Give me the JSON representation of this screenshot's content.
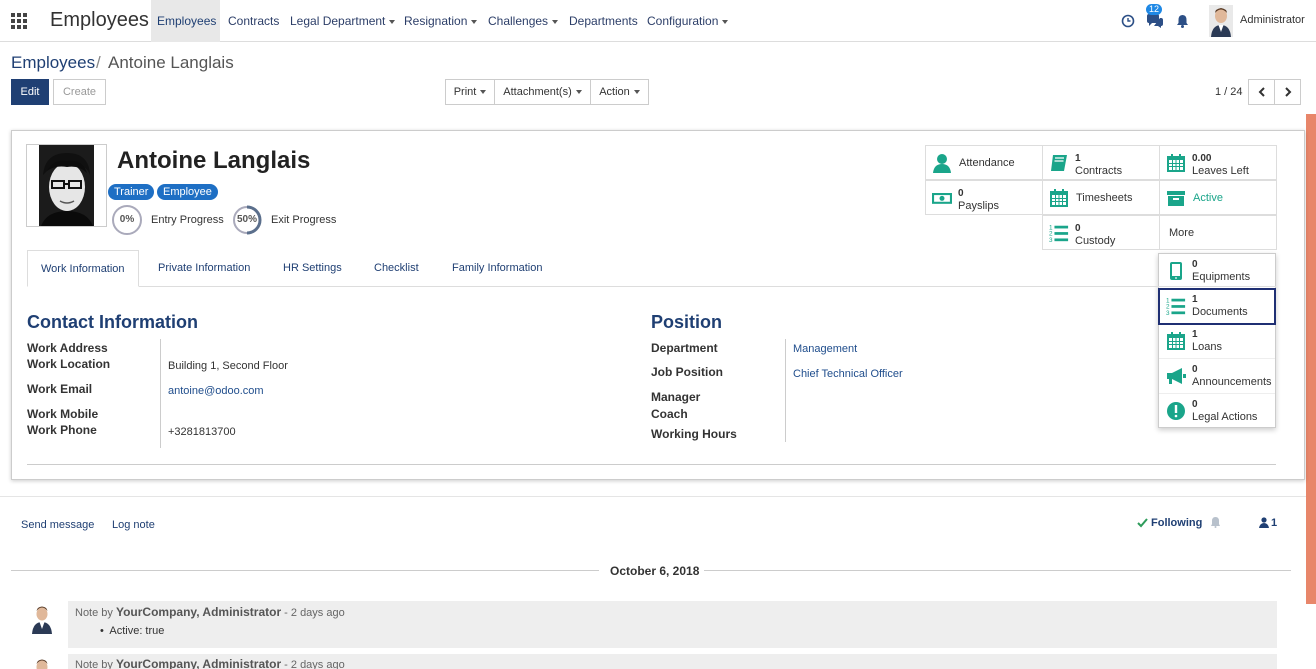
{
  "topnav": {
    "brand": "Employees",
    "menu": [
      {
        "label": "Employees",
        "dropdown": false
      },
      {
        "label": "Contracts",
        "dropdown": false
      },
      {
        "label": "Legal Department",
        "dropdown": true
      },
      {
        "label": "Resignation",
        "dropdown": true
      },
      {
        "label": "Challenges",
        "dropdown": true
      },
      {
        "label": "Departments",
        "dropdown": false
      },
      {
        "label": "Configuration",
        "dropdown": true
      }
    ],
    "messages_count": "12",
    "user": "Administrator"
  },
  "breadcrumb": {
    "root": "Employees",
    "separator": "/",
    "current": "Antoine Langlais"
  },
  "toolbar": {
    "edit": "Edit",
    "create": "Create",
    "print": "Print",
    "attachments": "Attachment(s)",
    "action": "Action",
    "pager": "1 / 24"
  },
  "employee": {
    "name": "Antoine Langlais",
    "tags": [
      "Trainer",
      "Employee"
    ],
    "entry_progress_value": "0%",
    "entry_progress_label": "Entry Progress",
    "exit_progress_value": "50%",
    "exit_progress_label": "Exit Progress"
  },
  "tabs": [
    "Work Information",
    "Private Information",
    "HR Settings",
    "Checklist",
    "Family Information"
  ],
  "contact": {
    "title": "Contact Information",
    "work_address_label": "Work Address",
    "work_location_label": "Work Location",
    "work_location": "Building 1, Second Floor",
    "work_email_label": "Work Email",
    "work_email": "antoine@odoo.com",
    "work_mobile_label": "Work Mobile",
    "work_phone_label": "Work Phone",
    "work_phone": "+3281813700"
  },
  "position": {
    "title": "Position",
    "department_label": "Department",
    "department": "Management",
    "job_position_label": "Job Position",
    "job_position": "Chief Technical Officer",
    "manager_label": "Manager",
    "coach_label": "Coach",
    "working_hours_label": "Working Hours"
  },
  "smart_buttons": {
    "attendance": "Attendance",
    "contracts_count": "1",
    "contracts": "Contracts",
    "leaves_count": "0.00",
    "leaves": "Leaves Left",
    "payslips_count": "0",
    "payslips": "Payslips",
    "timesheets": "Timesheets",
    "active": "Active",
    "custody_count": "0",
    "custody": "Custody",
    "more": "More"
  },
  "more_menu": [
    {
      "count": "0",
      "label": "Equipments"
    },
    {
      "count": "1",
      "label": "Documents"
    },
    {
      "count": "1",
      "label": "Loans"
    },
    {
      "count": "0",
      "label": "Announcements"
    },
    {
      "count": "0",
      "label": "Legal Actions"
    }
  ],
  "chatter": {
    "send_message": "Send message",
    "log_note": "Log note",
    "following": "Following",
    "followers": "1",
    "date": "October 6, 2018",
    "notes": [
      {
        "prefix": "Note by",
        "author": "YourCompany, Administrator",
        "time": "- 2 days ago",
        "body": "Active: true"
      },
      {
        "prefix": "Note by",
        "author": "YourCompany, Administrator",
        "time": "- 2 days ago",
        "body": ""
      }
    ]
  },
  "colors": {
    "brand": "#1f3f73",
    "accent_green": "#1aa58a",
    "tag_blue": "#1e6fc4",
    "stripe": "#e8866a"
  }
}
